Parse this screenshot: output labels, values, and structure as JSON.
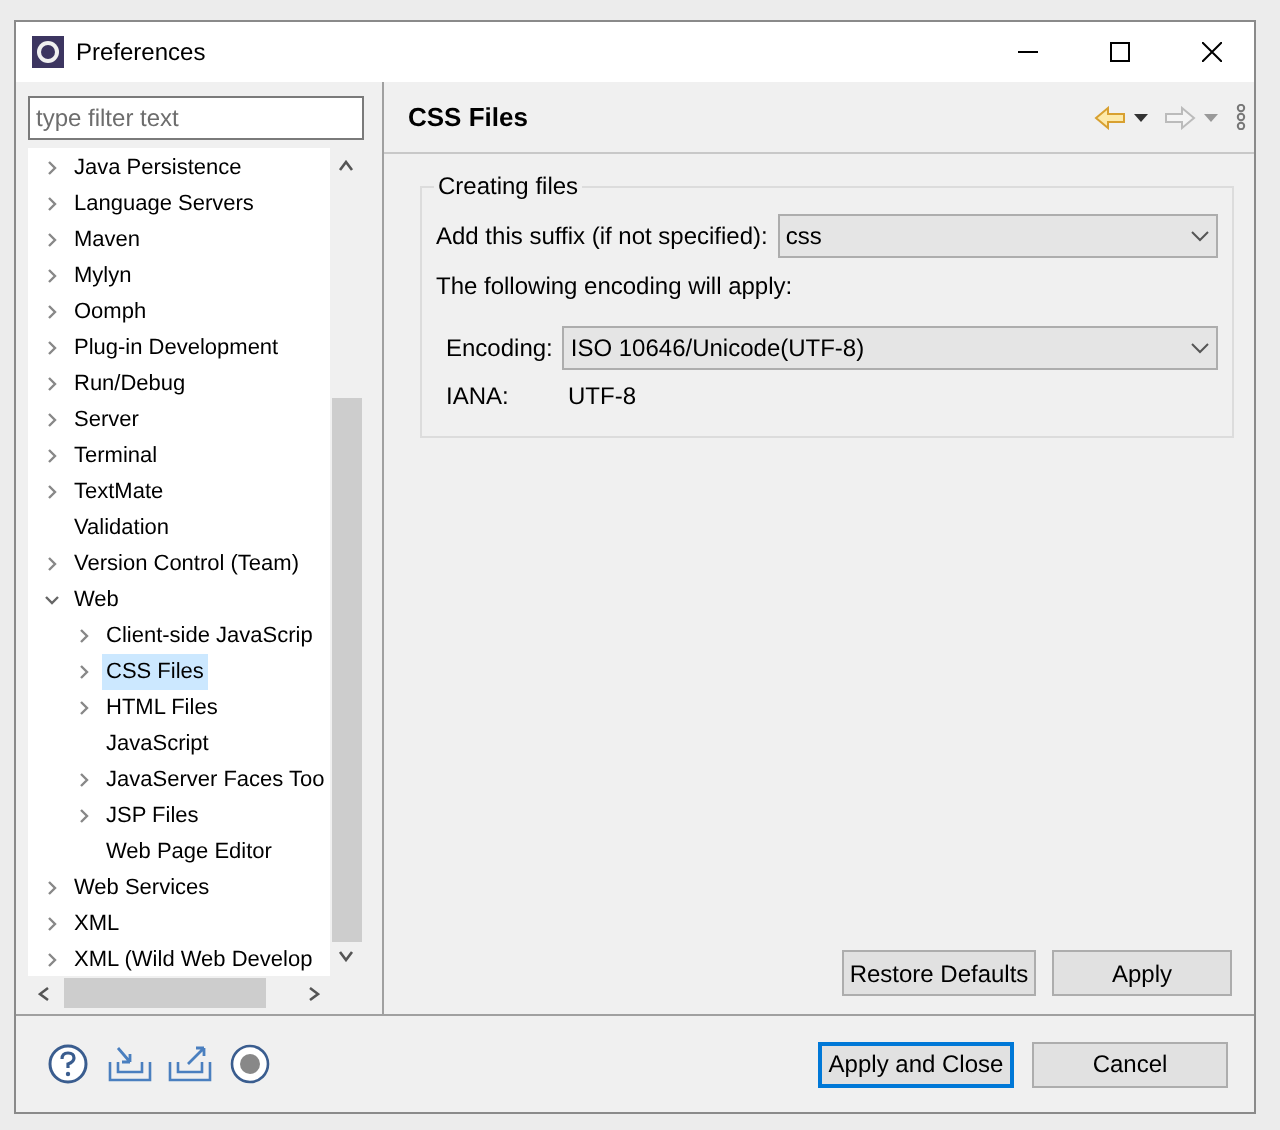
{
  "window": {
    "title": "Preferences"
  },
  "filter": {
    "placeholder": "type filter text"
  },
  "tree": [
    {
      "label": "Java Persistence",
      "kind": "folder",
      "expanded": false,
      "selected": false
    },
    {
      "label": "Language Servers",
      "kind": "folder",
      "expanded": false,
      "selected": false
    },
    {
      "label": "Maven",
      "kind": "folder",
      "expanded": false,
      "selected": false
    },
    {
      "label": "Mylyn",
      "kind": "folder",
      "expanded": false,
      "selected": false
    },
    {
      "label": "Oomph",
      "kind": "folder",
      "expanded": false,
      "selected": false
    },
    {
      "label": "Plug-in Development",
      "kind": "folder",
      "expanded": false,
      "selected": false
    },
    {
      "label": "Run/Debug",
      "kind": "folder",
      "expanded": false,
      "selected": false
    },
    {
      "label": "Server",
      "kind": "folder",
      "expanded": false,
      "selected": false
    },
    {
      "label": "Terminal",
      "kind": "folder",
      "expanded": false,
      "selected": false
    },
    {
      "label": "TextMate",
      "kind": "folder",
      "expanded": false,
      "selected": false
    },
    {
      "label": "Validation",
      "kind": "leaf",
      "selected": false
    },
    {
      "label": "Version Control (Team)",
      "kind": "folder",
      "expanded": false,
      "selected": false
    },
    {
      "label": "Web",
      "kind": "folder",
      "expanded": true,
      "selected": false,
      "children": [
        {
          "label": "Client-side JavaScrip",
          "kind": "folder",
          "expanded": false,
          "selected": false
        },
        {
          "label": "CSS Files",
          "kind": "folder",
          "expanded": false,
          "selected": true
        },
        {
          "label": "HTML Files",
          "kind": "folder",
          "expanded": false,
          "selected": false
        },
        {
          "label": "JavaScript",
          "kind": "leaf",
          "selected": false
        },
        {
          "label": "JavaServer Faces Too",
          "kind": "folder",
          "expanded": false,
          "selected": false
        },
        {
          "label": "JSP Files",
          "kind": "folder",
          "expanded": false,
          "selected": false
        },
        {
          "label": "Web Page Editor",
          "kind": "leaf",
          "selected": false
        }
      ]
    },
    {
      "label": "Web Services",
      "kind": "folder",
      "expanded": false,
      "selected": false
    },
    {
      "label": "XML",
      "kind": "folder",
      "expanded": false,
      "selected": false
    },
    {
      "label": "XML (Wild Web Develop",
      "kind": "folder",
      "expanded": false,
      "selected": false
    }
  ],
  "page": {
    "title": "CSS Files",
    "group": {
      "title": "Creating files",
      "suffix_label": "Add this suffix (if not specified):",
      "suffix_value": "css",
      "encoding_note": "The following encoding will apply:",
      "encoding_label": "Encoding:",
      "encoding_value": "ISO 10646/Unicode(UTF-8)",
      "iana_label": "IANA:",
      "iana_value": "UTF-8"
    },
    "buttons": [
      "Restore Defaults",
      "Apply"
    ]
  },
  "footer_buttons": [
    {
      "label": "Apply and Close",
      "default": true
    },
    {
      "label": "Cancel",
      "default": false
    }
  ]
}
